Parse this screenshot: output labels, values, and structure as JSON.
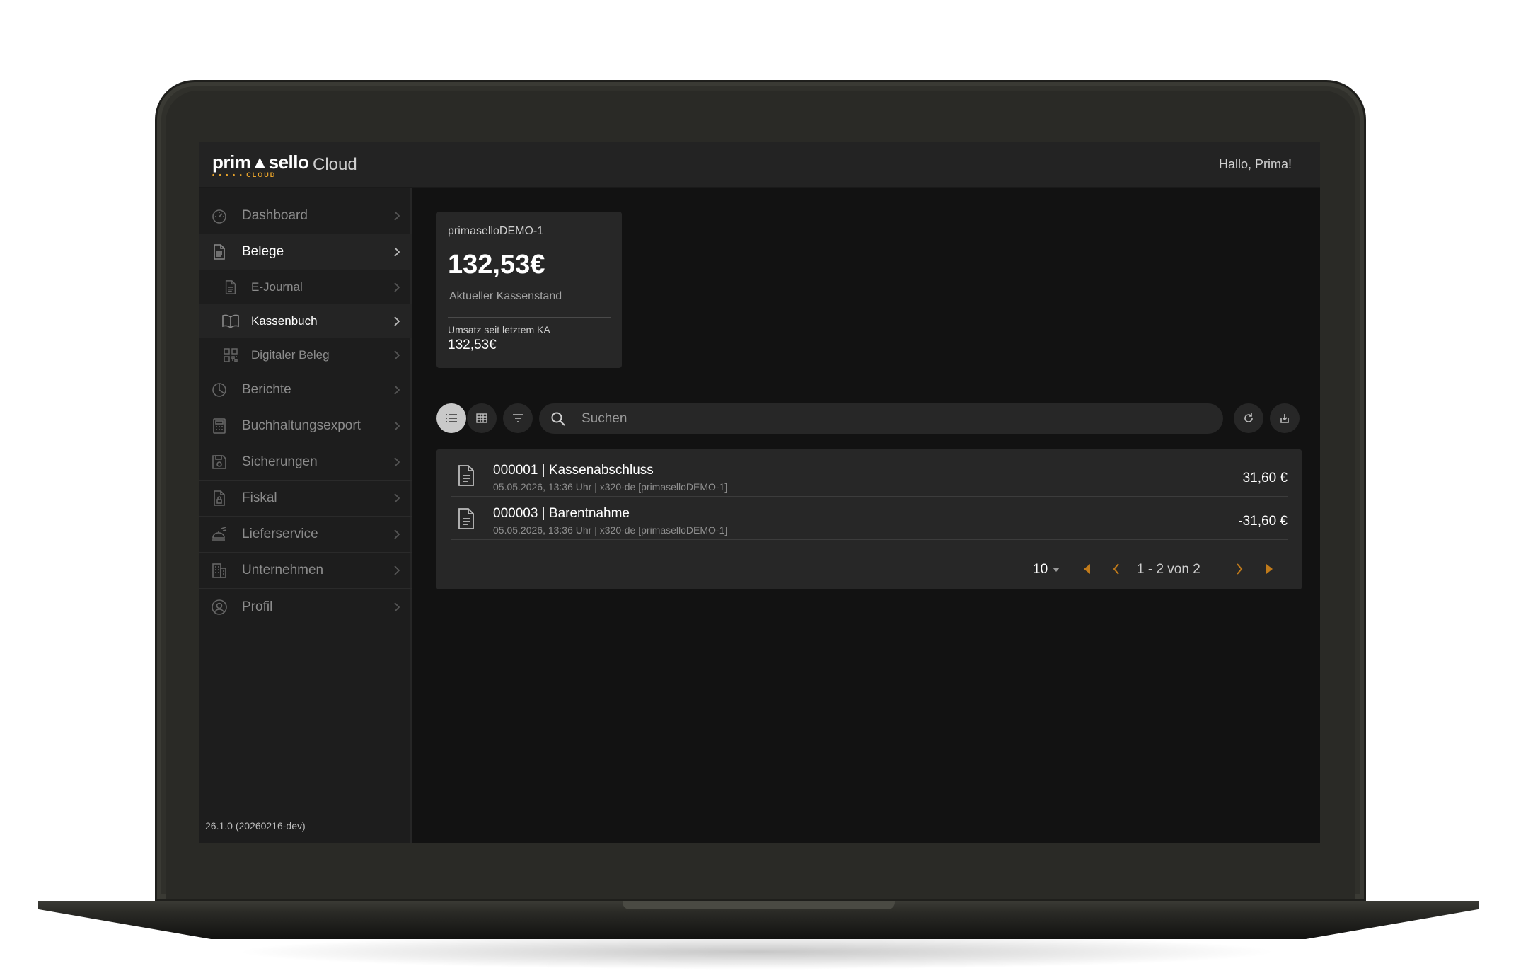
{
  "app": {
    "logo_text": "prim▲sello",
    "logo_sub": "• • • • • CLOUD",
    "name": "Cloud",
    "greeting": "Hallo, Prima!"
  },
  "sidebar": {
    "items": [
      {
        "label": "Dashboard",
        "icon": "gauge-icon"
      },
      {
        "label": "Belege",
        "icon": "document-icon",
        "active": true
      },
      {
        "label": "E-Journal",
        "icon": "document-icon",
        "sub": true
      },
      {
        "label": "Kassenbuch",
        "icon": "book-icon",
        "sub": true,
        "active": true
      },
      {
        "label": "Digitaler Beleg",
        "icon": "qr-code-icon",
        "sub": true
      },
      {
        "label": "Berichte",
        "icon": "pie-chart-icon"
      },
      {
        "label": "Buchhaltungsexport",
        "icon": "calculator-icon"
      },
      {
        "label": "Sicherungen",
        "icon": "save-icon"
      },
      {
        "label": "Fiskal",
        "icon": "lock-document-icon"
      },
      {
        "label": "Lieferservice",
        "icon": "delivery-icon"
      },
      {
        "label": "Unternehmen",
        "icon": "building-icon"
      },
      {
        "label": "Profil",
        "icon": "user-icon"
      }
    ],
    "version": "26.1.0 (20260216-dev)"
  },
  "card": {
    "title": "primaselloDEMO-1",
    "amount": "132,53€",
    "label": "Aktueller Kassenstand",
    "sublabel": "Umsatz seit letztem KA",
    "subvalue": "132,53€"
  },
  "toolbar": {
    "search_placeholder": "Suchen",
    "view_mode": "list"
  },
  "list": {
    "rows": [
      {
        "title": "000001 | Kassenabschluss",
        "meta": "05.05.2026, 13:36 Uhr | x320-de [primaselloDEMO-1]",
        "amount": "31,60 €"
      },
      {
        "title": "000003 | Barentnahme",
        "meta": "05.05.2026, 13:36 Uhr | x320-de [primaselloDEMO-1]",
        "amount": "-31,60 €"
      }
    ]
  },
  "pager": {
    "page_size": "10",
    "range": "1 - 2 von 2"
  },
  "colors": {
    "accent": "#e8a32a",
    "background": "#121212",
    "surface": "#272727",
    "sidebar": "#1d1d1d"
  }
}
